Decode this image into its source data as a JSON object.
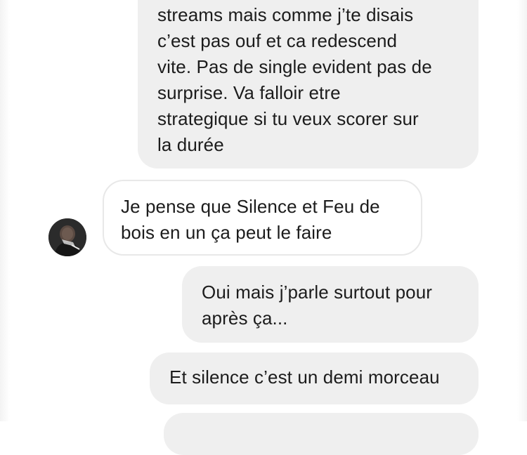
{
  "conversation": {
    "messages": [
      {
        "direction": "sent",
        "text": "streams mais comme j’te disais\nc’est pas ouf et ca redescend\nvite. Pas de single evident pas de\nsurprise. Va falloir etre\nstrategique si tu veux scorer sur\nla durée"
      },
      {
        "direction": "received",
        "text": "Je pense que Silence et Feu de\nbois en un ça peut le faire"
      },
      {
        "direction": "sent",
        "text": "Oui mais j’parle surtout pour\naprès ça..."
      },
      {
        "direction": "sent",
        "text": "Et silence c’est un demi morceau"
      },
      {
        "direction": "sent",
        "text": ""
      }
    ],
    "avatar_icon": "profile-photo-icon",
    "colors": {
      "sent_bubble": "#efefef",
      "received_border": "#e8e8e8",
      "text": "#1c1c1c"
    }
  }
}
